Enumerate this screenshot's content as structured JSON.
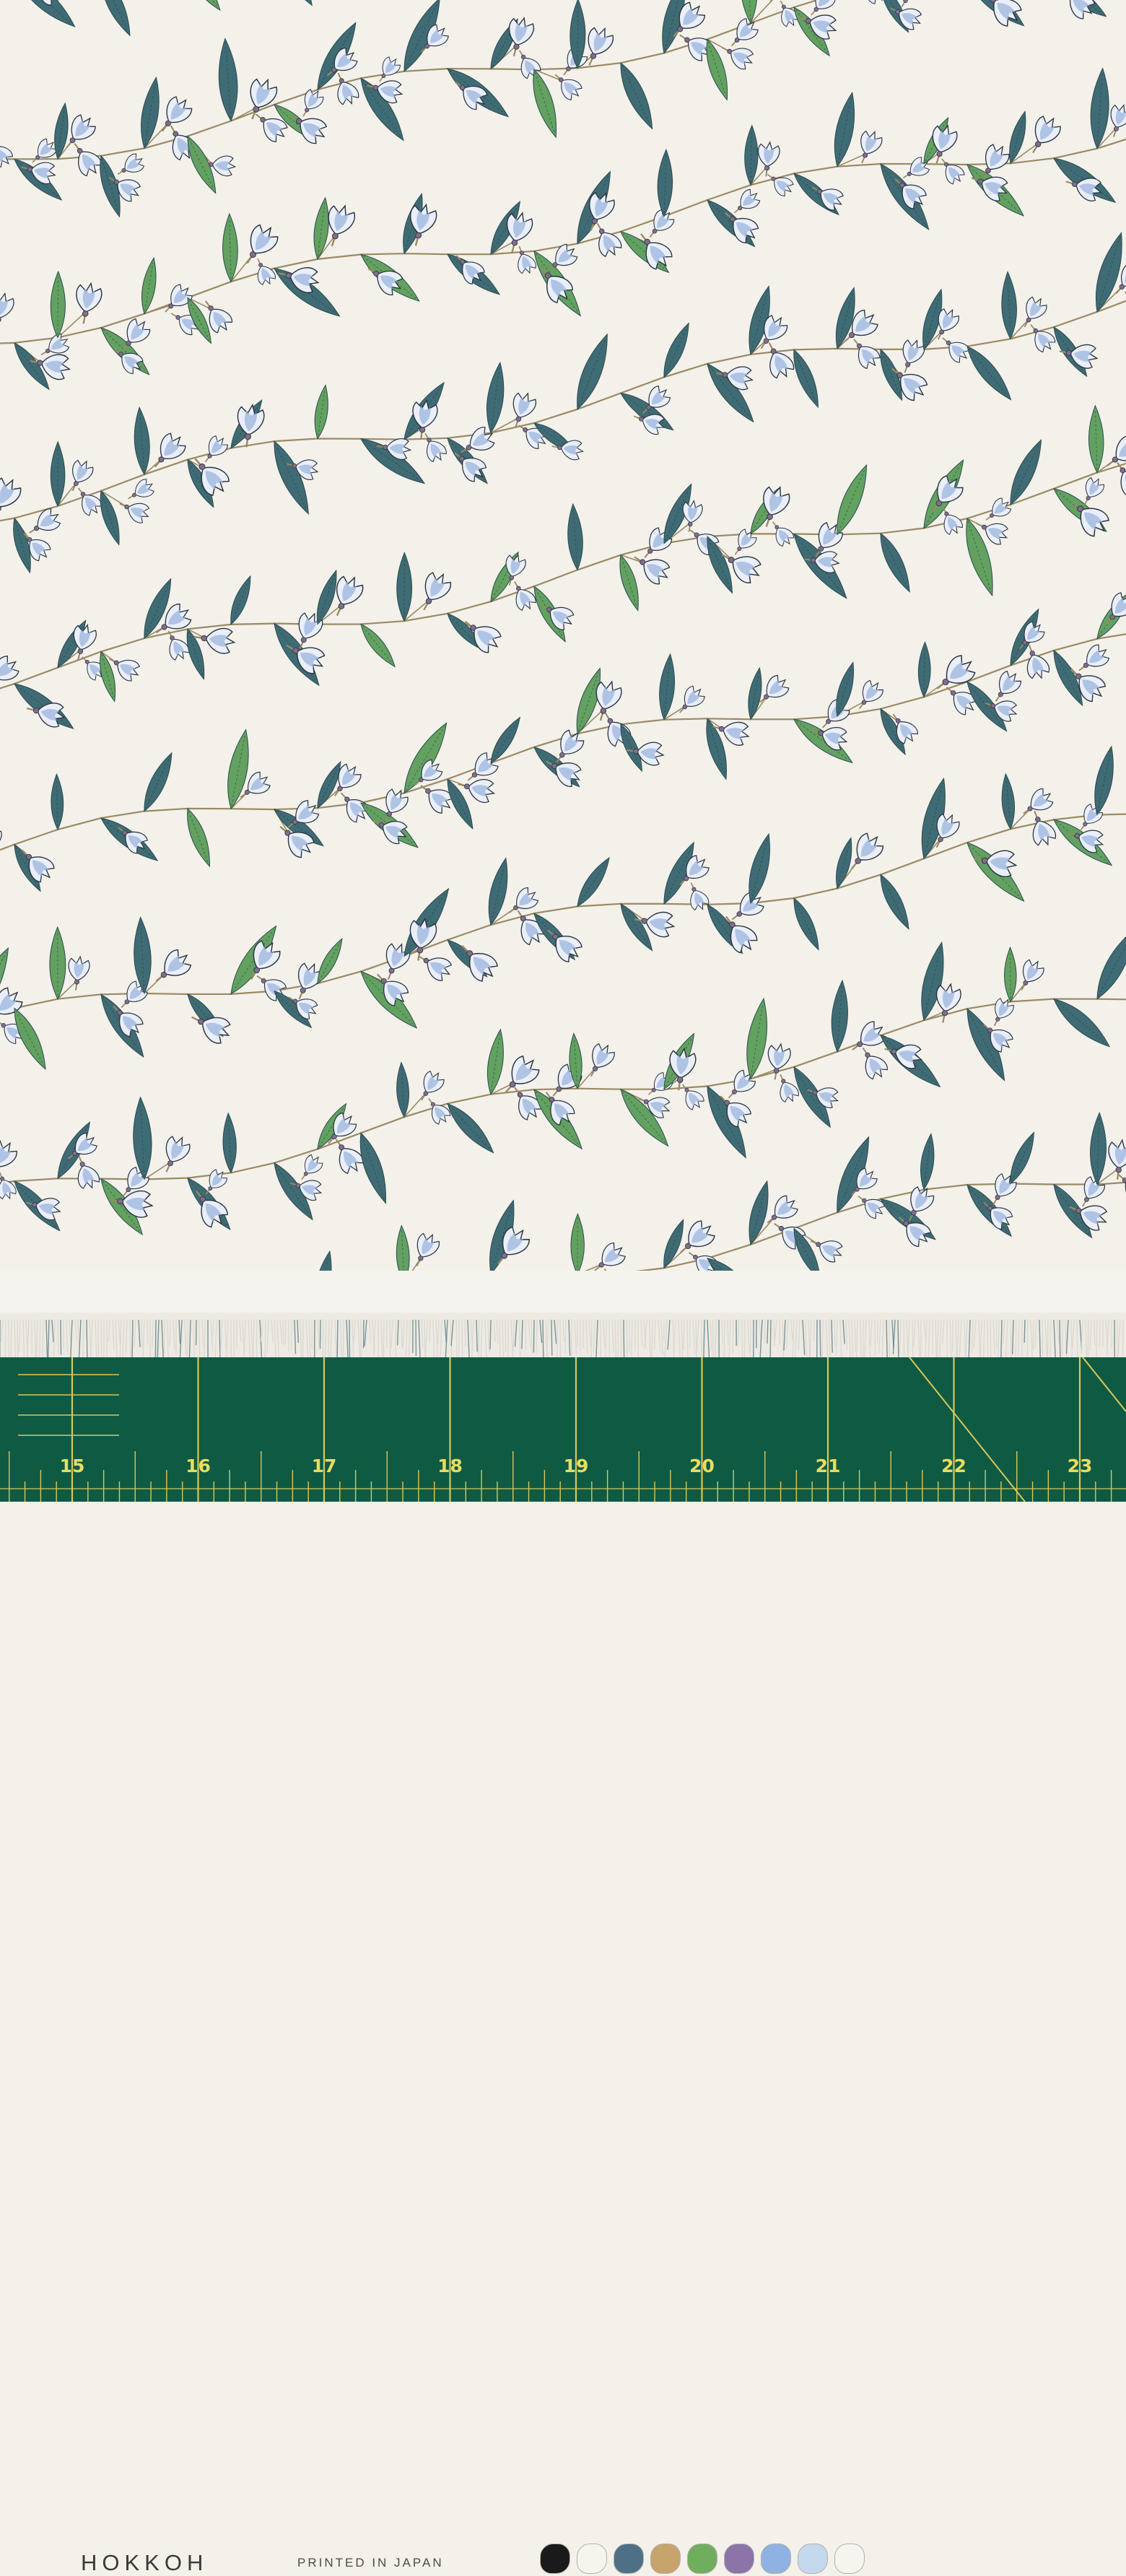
{
  "selvage": {
    "brand": "HOKKOH",
    "printed_text": "PRINTED IN JAPAN",
    "color_chips": [
      "#1a1a1a",
      "#f5f4ef",
      "#4e7086",
      "#c7a46c",
      "#6fae5d",
      "#8c73a8",
      "#8fb2e3",
      "#c4d8ee",
      "#f5f4ef"
    ]
  },
  "ruler": {
    "numbers": [
      "15",
      "16",
      "17",
      "18",
      "19",
      "20",
      "21",
      "22",
      "23"
    ],
    "line_color": "#d8c85a",
    "mat_color": "#0f5a43"
  },
  "palette": {
    "background": "#f3f1ea",
    "leaf_dark": "#3f6b74",
    "leaf_green": "#62a160",
    "flower": "#9bb4df",
    "stem": "#9a8a64"
  }
}
